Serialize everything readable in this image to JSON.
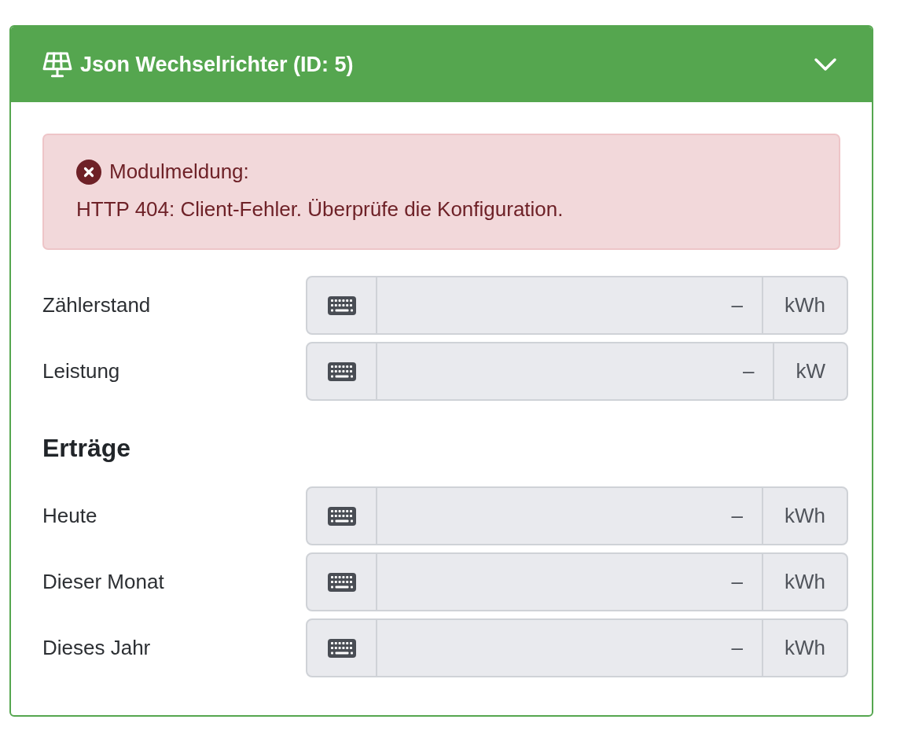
{
  "panel": {
    "title": "Json Wechselrichter (ID: 5)",
    "expanded": true
  },
  "alert": {
    "kind": "error",
    "title": "Modulmeldung:",
    "message": "HTTP 404: Client-Fehler. Überprüfe die Konfiguration."
  },
  "fields": [
    {
      "label": "Zählerstand",
      "value": "–",
      "unit": "kWh",
      "disabled": true
    },
    {
      "label": "Leistung",
      "value": "–",
      "unit": "kW",
      "disabled": true
    }
  ],
  "yields": {
    "heading": "Erträge",
    "fields": [
      {
        "label": "Heute",
        "value": "–",
        "unit": "kWh",
        "disabled": true
      },
      {
        "label": "Dieser Monat",
        "value": "–",
        "unit": "kWh",
        "disabled": true
      },
      {
        "label": "Dieses Jahr",
        "value": "–",
        "unit": "kWh",
        "disabled": true
      }
    ]
  }
}
